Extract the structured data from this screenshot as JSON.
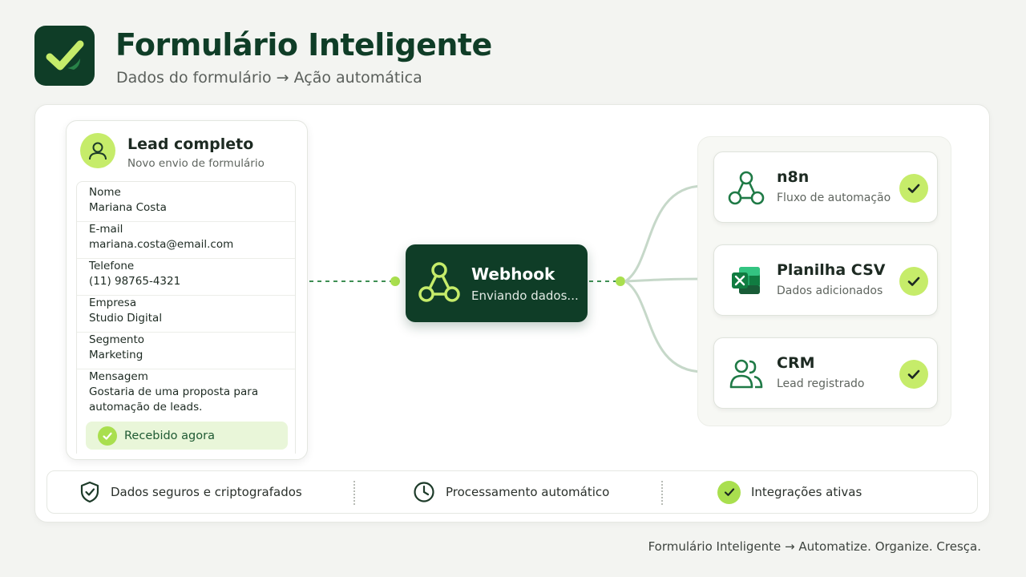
{
  "header": {
    "logo_icon": "check-icon",
    "title": "Formulário Inteligente",
    "subtitle": "Dados do formulário → Ação automática"
  },
  "lead": {
    "avatar_icon": "user-icon",
    "title": "Lead completo",
    "subtitle": "Novo envio de formulário",
    "fields": [
      {
        "label": "Nome",
        "value": "Mariana Costa"
      },
      {
        "label": "E-mail",
        "value": "mariana.costa@email.com"
      },
      {
        "label": "Telefone",
        "value": "(11) 98765-4321"
      },
      {
        "label": "Empresa",
        "value": "Studio Digital"
      },
      {
        "label": "Segmento",
        "value": "Marketing"
      },
      {
        "label": "Mensagem",
        "value_lines": [
          "Gostaria de uma proposta para",
          "automação de leads."
        ]
      }
    ],
    "status": "Recebido agora"
  },
  "webhook": {
    "icon": "webhook-icon",
    "title": "Webhook",
    "subtitle": "Enviando dados..."
  },
  "destinations": [
    {
      "icon": "n8n-icon",
      "title": "n8n",
      "subtitle": "Fluxo de automação"
    },
    {
      "icon": "excel-icon",
      "title": "Planilha CSV",
      "subtitle": "Dados adicionados"
    },
    {
      "icon": "users-icon",
      "title": "CRM",
      "subtitle": "Lead registrado"
    }
  ],
  "features": [
    {
      "icon": "shield-check-icon",
      "label": "Dados seguros e criptografados"
    },
    {
      "icon": "clock-icon",
      "label": "Processamento automático"
    },
    {
      "icon": "check-circle-icon",
      "label": "Integrações ativas"
    }
  ],
  "tagline": "Formulário Inteligente → Automatize. Organize. Cresça.",
  "colors": {
    "primary_dark": "#0f3d27",
    "accent_lime": "#c6ec6a",
    "connector": "#6aa84f",
    "background": "#f3f4f1"
  }
}
